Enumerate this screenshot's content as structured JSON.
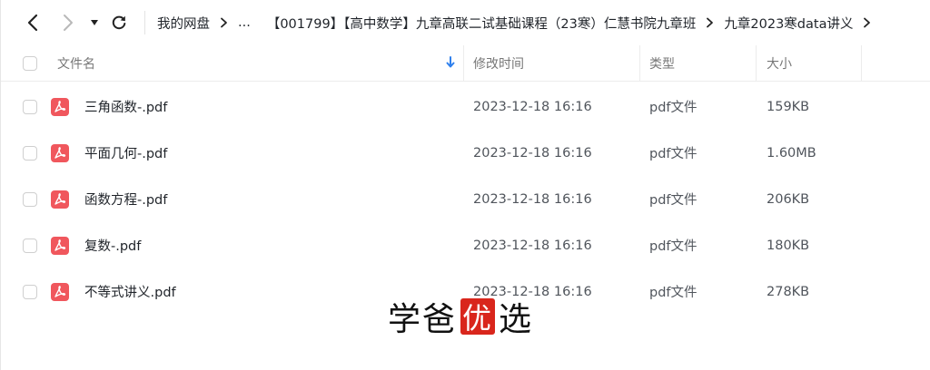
{
  "toolbar": {
    "back_icon": "chevron-left-icon",
    "forward_icon": "chevron-right-icon",
    "dropdown_icon": "caret-down-icon",
    "refresh_icon": "refresh-icon"
  },
  "breadcrumb": [
    "我的网盘",
    "...",
    "【001799】【高中数学】九章高联二试基础课程（23寒）仁慧书院九章班",
    "九章2023寒data讲义"
  ],
  "columns": {
    "name": "文件名",
    "modified": "修改时间",
    "type": "类型",
    "size": "大小",
    "sort_icon": "sort-down-arrow-icon",
    "sort_color": "#2f80ed"
  },
  "files": [
    {
      "name": "三角函数-.pdf",
      "modified": "2023-12-18 16:16",
      "type": "pdf文件",
      "size": "159KB"
    },
    {
      "name": "平面几何-.pdf",
      "modified": "2023-12-18 16:16",
      "type": "pdf文件",
      "size": "1.60MB"
    },
    {
      "name": "函数方程-.pdf",
      "modified": "2023-12-18 16:16",
      "type": "pdf文件",
      "size": "206KB"
    },
    {
      "name": "复数-.pdf",
      "modified": "2023-12-18 16:16",
      "type": "pdf文件",
      "size": "180KB"
    },
    {
      "name": "不等式讲义.pdf",
      "modified": "2023-12-18 16:16",
      "type": "pdf文件",
      "size": "278KB"
    }
  ],
  "pdf_icon_color": "#f0575d",
  "watermark": {
    "text_1": "学爸",
    "badge": "优",
    "text_2": "选",
    "badge_color": "#d9261c"
  }
}
